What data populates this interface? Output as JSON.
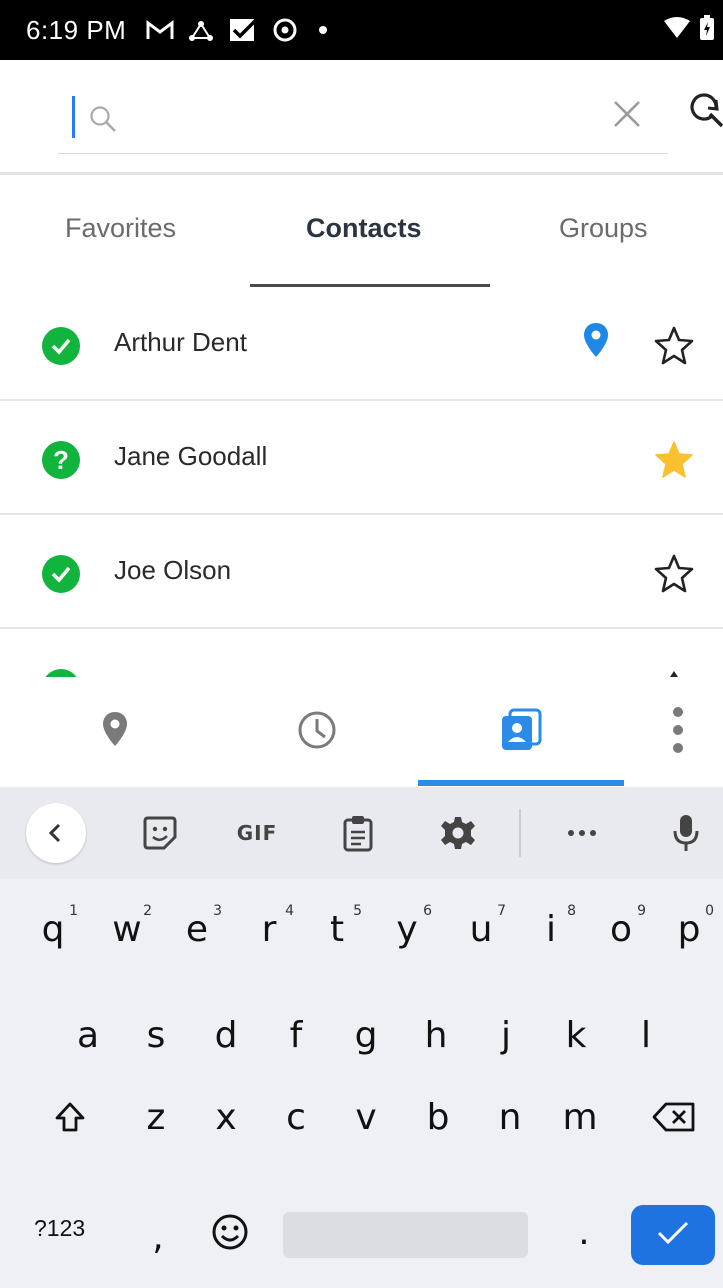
{
  "status_bar": {
    "time": "6:19 PM",
    "icons": [
      "gmail-icon",
      "network-icon",
      "inbox-check-icon",
      "vpn-icon",
      "notification-dot-icon"
    ],
    "right_icons": [
      "wifi-icon",
      "battery-icon"
    ]
  },
  "search": {
    "value": "",
    "placeholder": "",
    "clear_icon": "close-icon",
    "advanced_icon": "search-refresh-icon"
  },
  "tabs": [
    {
      "label": "Favorites",
      "active": false
    },
    {
      "label": "Contacts",
      "active": true
    },
    {
      "label": "Groups",
      "active": false
    }
  ],
  "contacts": [
    {
      "name": "Arthur Dent",
      "status": "online",
      "status_icon": "check-icon",
      "has_location": true,
      "favorite": false
    },
    {
      "name": "Jane Goodall",
      "status": "unknown",
      "status_icon": "question-icon",
      "has_location": false,
      "favorite": true
    },
    {
      "name": "Joe Olson",
      "status": "online",
      "status_icon": "check-icon",
      "has_location": false,
      "favorite": false
    }
  ],
  "bottom_nav": {
    "items": [
      "location-pin-icon",
      "clock-icon",
      "contacts-book-icon",
      "more-vertical-icon"
    ],
    "active_index": 2
  },
  "keyboard": {
    "toolbar": {
      "collapse_icon": "chevron-left-icon",
      "sticker_icon": "sticker-icon",
      "gif_label": "GIF",
      "clipboard_icon": "clipboard-icon",
      "settings_icon": "gear-icon",
      "more_icon": "more-horizontal-icon",
      "mic_icon": "microphone-icon"
    },
    "row1": [
      {
        "k": "q",
        "s": "1"
      },
      {
        "k": "w",
        "s": "2"
      },
      {
        "k": "e",
        "s": "3"
      },
      {
        "k": "r",
        "s": "4"
      },
      {
        "k": "t",
        "s": "5"
      },
      {
        "k": "y",
        "s": "6"
      },
      {
        "k": "u",
        "s": "7"
      },
      {
        "k": "i",
        "s": "8"
      },
      {
        "k": "o",
        "s": "9"
      },
      {
        "k": "p",
        "s": "0"
      }
    ],
    "row2": [
      "a",
      "s",
      "d",
      "f",
      "g",
      "h",
      "j",
      "k",
      "l"
    ],
    "row3": [
      "z",
      "x",
      "c",
      "v",
      "b",
      "n",
      "m"
    ],
    "symbols_label": "?123",
    "comma_label": ",",
    "period_label": ".",
    "emoji_icon": "emoji-icon",
    "shift_icon": "shift-icon",
    "backspace_icon": "backspace-icon",
    "enter_icon": "checkmark-icon"
  },
  "colors": {
    "accent_blue": "#2b8ce8",
    "status_green": "#11b43c",
    "favorite_yellow": "#fbc02d",
    "location_blue": "#1e88e5",
    "enter_key": "#1f73e0"
  }
}
